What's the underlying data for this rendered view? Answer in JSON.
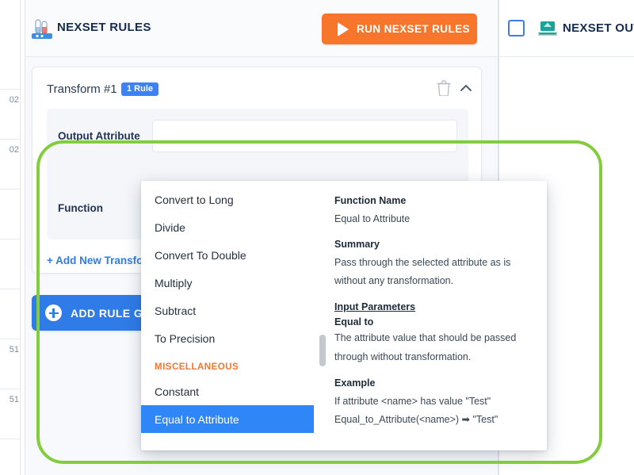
{
  "left_rail": {
    "items": [
      {
        "text": "02"
      },
      {
        "text": "02"
      },
      {
        "text": ""
      },
      {
        "text": ""
      },
      {
        "text": ""
      },
      {
        "text": "51"
      },
      {
        "text": "51"
      }
    ]
  },
  "header": {
    "icon": "test-tubes-icon",
    "title": "NEXSET RULES",
    "run_button": {
      "label": "RUN NEXSET RULES",
      "icon": "play-icon",
      "color": "#f7762c"
    }
  },
  "right_header": {
    "checkbox_checked": false,
    "icon": "laptop-output-icon",
    "title": "NEXSET OUTPUT"
  },
  "card": {
    "title": "Transform #1",
    "badge": "1 Rule",
    "badge_color": "#3b82f6",
    "delete_icon": "trash-icon",
    "collapse_icon": "chevron-up-icon",
    "output_attribute": {
      "label": "Output Attribute",
      "value": "",
      "placeholder": ""
    },
    "function": {
      "label": "Function",
      "value": "Equal to Attribute",
      "chevron": "chevron-down-icon"
    },
    "ghost_text": "Equal to",
    "add_transform_label": "+ Add New Transform"
  },
  "add_rule_group": {
    "label": "ADD RULE GROUP",
    "icon": "plus-circle-icon",
    "color": "#2f7ce8"
  },
  "dropdown": {
    "items": [
      {
        "label": "Convert to Long",
        "type": "option",
        "selected": false
      },
      {
        "label": "Divide",
        "type": "option",
        "selected": false
      },
      {
        "label": "Convert To Double",
        "type": "option",
        "selected": false
      },
      {
        "label": "Multiply",
        "type": "option",
        "selected": false
      },
      {
        "label": "Subtract",
        "type": "option",
        "selected": false
      },
      {
        "label": "To Precision",
        "type": "option",
        "selected": false
      },
      {
        "label": "MISCELLANEOUS",
        "type": "section",
        "selected": false
      },
      {
        "label": "Constant",
        "type": "option",
        "selected": false
      },
      {
        "label": "Equal to Attribute",
        "type": "option",
        "selected": true
      }
    ],
    "selected_color": "#2f86f6",
    "section_color": "#f7762c",
    "detail": {
      "function_name_heading": "Function Name",
      "function_name_value": "Equal to Attribute",
      "summary_heading": "Summary",
      "summary_text": "Pass through the selected attribute as is without any transformation.",
      "input_parameters_heading": "Input Parameters",
      "param_name": "Equal to",
      "param_description": "The attribute value that should be passed through without transformation.",
      "example_heading": "Example",
      "example_line1": "If attribute <name> has value \"Test\"",
      "example_line2": "Equal_to_Attribute(<name>) ➡ \"Test\""
    }
  },
  "annotation": {
    "highlight_color": "#82cc3e"
  }
}
